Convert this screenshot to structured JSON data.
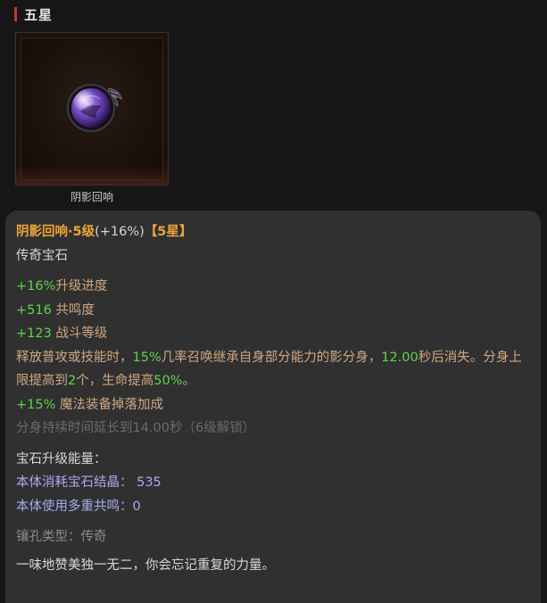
{
  "section": {
    "title": "五星"
  },
  "gem": {
    "caption": "阴影回响"
  },
  "tooltip": {
    "name": "阴影回响·5级",
    "upgrade_pct": "(+16%)",
    "star_tag": "【5星】",
    "type": "传奇宝石",
    "stats": [
      {
        "value": "+16%",
        "label": "升级进度"
      },
      {
        "value": "+516",
        "label": " 共鸣度"
      },
      {
        "value": "+123",
        "label": " 战斗等级"
      }
    ],
    "effect": {
      "p1": "释放普攻或技能时，",
      "v1": "15%",
      "p2": "几率召唤继承自身部分能力的影分身，",
      "v2": "12.00",
      "p3": "秒后消失。分身上限提高到",
      "v3": "2",
      "p4": "个，生命提高",
      "v4": "50%",
      "p5": "。"
    },
    "magic_drop": {
      "value": "+15%",
      "label": " 魔法装备掉落加成"
    },
    "locked_line": "分身持续时间延长到14.00秒（6级解锁）",
    "energy_title": "宝石升级能量：",
    "energy_crystal": "本体消耗宝石结晶： 535",
    "energy_resonance": "本体使用多重共鸣：0",
    "socket_type": "镶孔类型：传奇",
    "flavor": "一味地赞美独一无二，你会忘记重复的力量。"
  },
  "colors": {
    "accent_orange": "#f0a43a",
    "stat_green": "#5fd34a",
    "effect_tan": "#cfa780",
    "energy_blue": "#aaaaf2",
    "header_bar_red": "#c0392b"
  },
  "icons": {
    "gem": "purple-shadow-gem-icon"
  }
}
